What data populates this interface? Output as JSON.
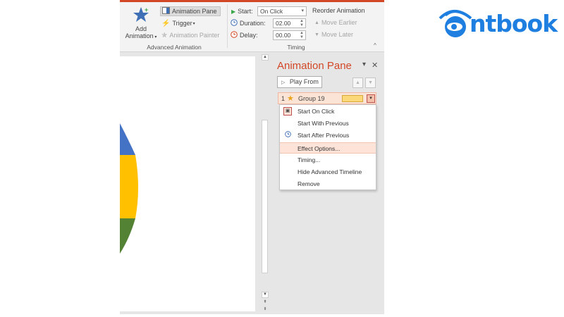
{
  "ribbon": {
    "add_animation": {
      "line1": "Add",
      "line2": "Animation"
    },
    "animation_pane_label": "Animation Pane",
    "trigger_label": "Trigger",
    "animation_painter_label": "Animation Painter",
    "group_advanced_label": "Advanced Animation",
    "start_label": "Start:",
    "start_value": "On Click",
    "duration_label": "Duration:",
    "duration_value": "02.00",
    "delay_label": "Delay:",
    "delay_value": "00.00",
    "group_timing_label": "Timing",
    "reorder_label": "Reorder Animation",
    "move_earlier_label": "Move Earlier",
    "move_later_label": "Move Later"
  },
  "pane": {
    "title": "Animation Pane",
    "play_from_label": "Play From",
    "item": {
      "number": "1",
      "name": "Group 19"
    },
    "menu_items": [
      {
        "label": "Start On Click",
        "icon": "mouse-click-icon"
      },
      {
        "label": "Start With Previous",
        "icon": ""
      },
      {
        "label": "Start After Previous",
        "icon": "clock-icon"
      },
      {
        "label": "Effect Options...",
        "icon": "",
        "highlighted": true
      },
      {
        "label": "Timing...",
        "icon": ""
      },
      {
        "label": "Hide Advanced Timeline",
        "icon": ""
      },
      {
        "label": "Remove",
        "icon": ""
      }
    ]
  },
  "logo": {
    "text": "ntbook"
  },
  "colors": {
    "accent": "#d24726",
    "pie_blue": "#4472c4",
    "pie_yellow": "#ffc000",
    "pie_green": "#548235",
    "logo_blue": "#1e7fe0",
    "timebar": "#fbd97a"
  }
}
